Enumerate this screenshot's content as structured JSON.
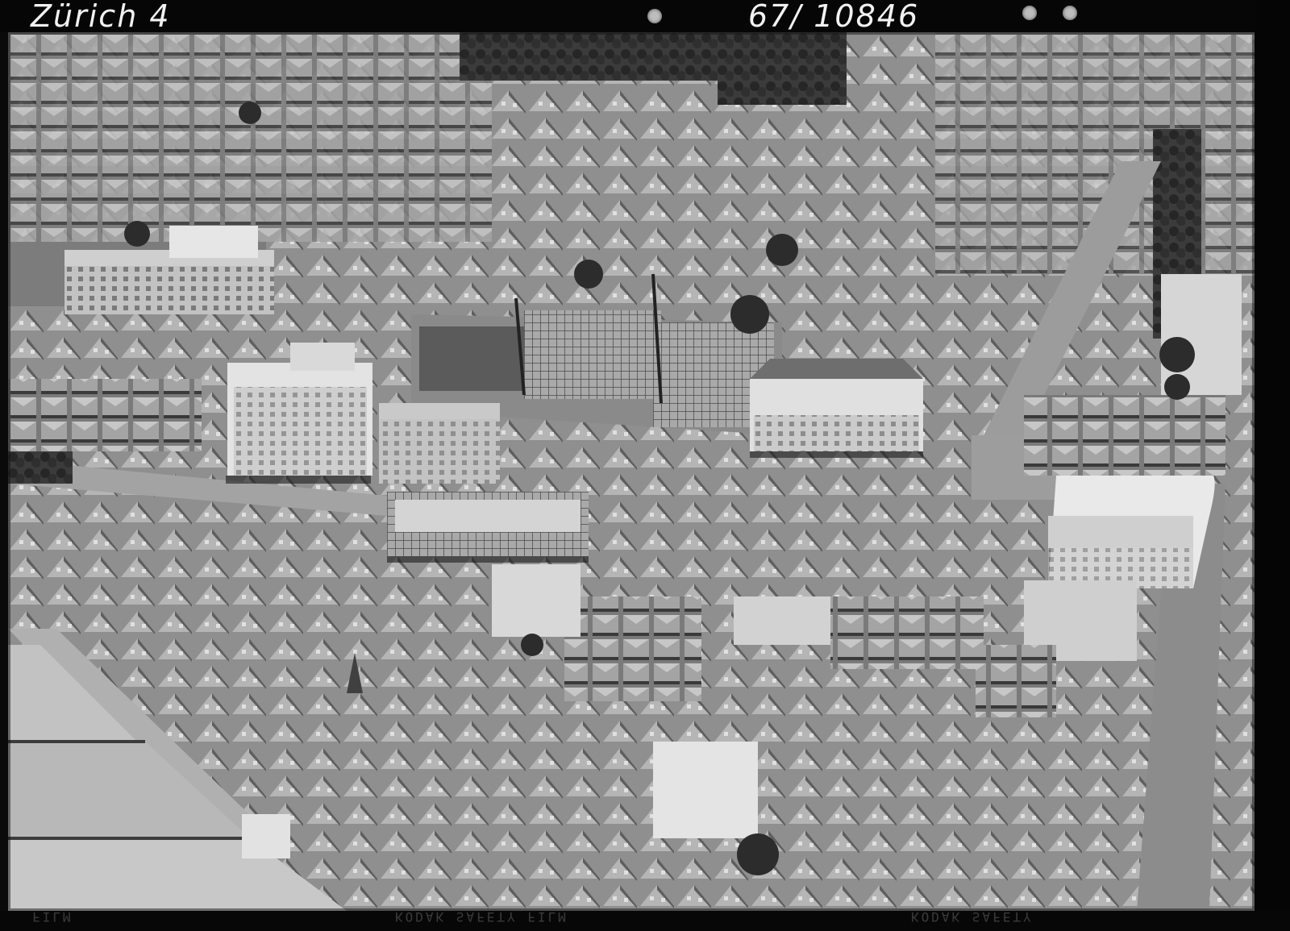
{
  "negative": {
    "place_label": "Zürich 4",
    "negative_number": "67/ 10846",
    "edge_print": [
      "FILM",
      "KODAK SAFETY FILM",
      "KODAK SAFETY"
    ]
  },
  "photo": {
    "subject": "aerial-photograph",
    "palette": {
      "film_border": "#0a0a0a",
      "roof_light": "#d9d9d9",
      "roof_mid": "#a6a6a6",
      "roof_dark": "#5a5a5a",
      "street": "#9d9d9d",
      "trees": "#2e2e2e",
      "shadow": "#1c1c1c"
    }
  }
}
